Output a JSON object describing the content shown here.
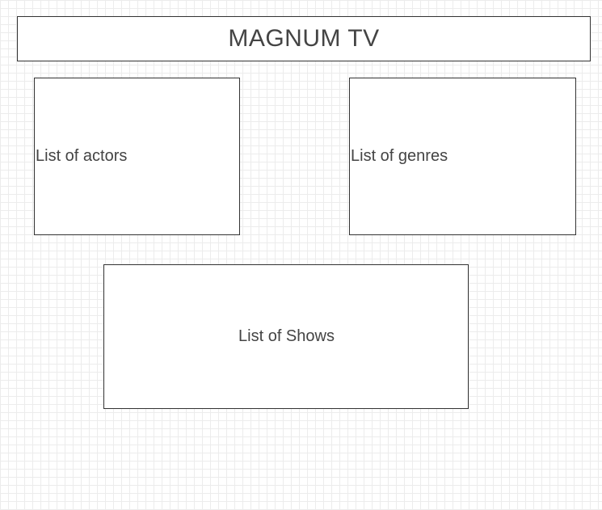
{
  "title": "MAGNUM TV",
  "boxes": {
    "actors": "List of actors",
    "genres": "List of genres",
    "shows": "List of Shows"
  },
  "colors": {
    "border": "#333333",
    "text": "#444444",
    "grid": "#ececec",
    "background": "#ffffff"
  }
}
